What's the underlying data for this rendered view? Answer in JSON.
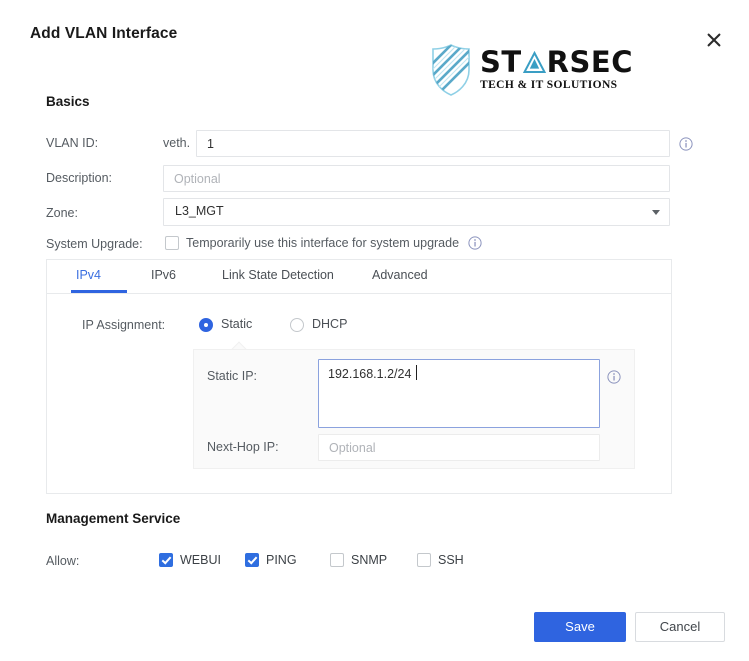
{
  "dialog": {
    "title": "Add VLAN Interface",
    "close_icon": "close-icon"
  },
  "brand": {
    "name_part1": "ST",
    "name_mark": "A",
    "name_part2": "RSEC",
    "tagline": "TECH & IT SOLUTIONS",
    "shield_icon": "shield-logo-icon",
    "accent_color": "#4a9fc6"
  },
  "basics": {
    "heading": "Basics",
    "vlan_id": {
      "label": "VLAN ID:",
      "prefix": "veth.",
      "value": "1",
      "info_icon": "info-icon"
    },
    "description": {
      "label": "Description:",
      "value": "",
      "placeholder": "Optional"
    },
    "zone": {
      "label": "Zone:",
      "value": "L3_MGT",
      "caret_icon": "chevron-down-icon"
    },
    "system_upgrade": {
      "label": "System Upgrade:",
      "checkbox_text": "Temporarily use this interface for system upgrade",
      "checked": false,
      "info_icon": "info-icon"
    }
  },
  "tabs": [
    {
      "label": "IPv4",
      "active": true
    },
    {
      "label": "IPv6",
      "active": false
    },
    {
      "label": "Link State Detection",
      "active": false
    },
    {
      "label": "Advanced",
      "active": false
    }
  ],
  "ipv4": {
    "ip_assignment": {
      "label": "IP Assignment:",
      "options": [
        {
          "label": "Static",
          "selected": true
        },
        {
          "label": "DHCP",
          "selected": false
        }
      ]
    },
    "static_ip": {
      "label": "Static IP:",
      "value": "192.168.1.2/24",
      "info_icon": "info-icon"
    },
    "next_hop_ip": {
      "label": "Next-Hop IP:",
      "value": "",
      "placeholder": "Optional"
    }
  },
  "management_service": {
    "heading": "Management Service",
    "allow_label": "Allow:",
    "services": [
      {
        "label": "WEBUI",
        "checked": true
      },
      {
        "label": "PING",
        "checked": true
      },
      {
        "label": "SNMP",
        "checked": false
      },
      {
        "label": "SSH",
        "checked": false
      }
    ]
  },
  "footer": {
    "save_label": "Save",
    "cancel_label": "Cancel",
    "primary_color": "#2f64e0"
  }
}
